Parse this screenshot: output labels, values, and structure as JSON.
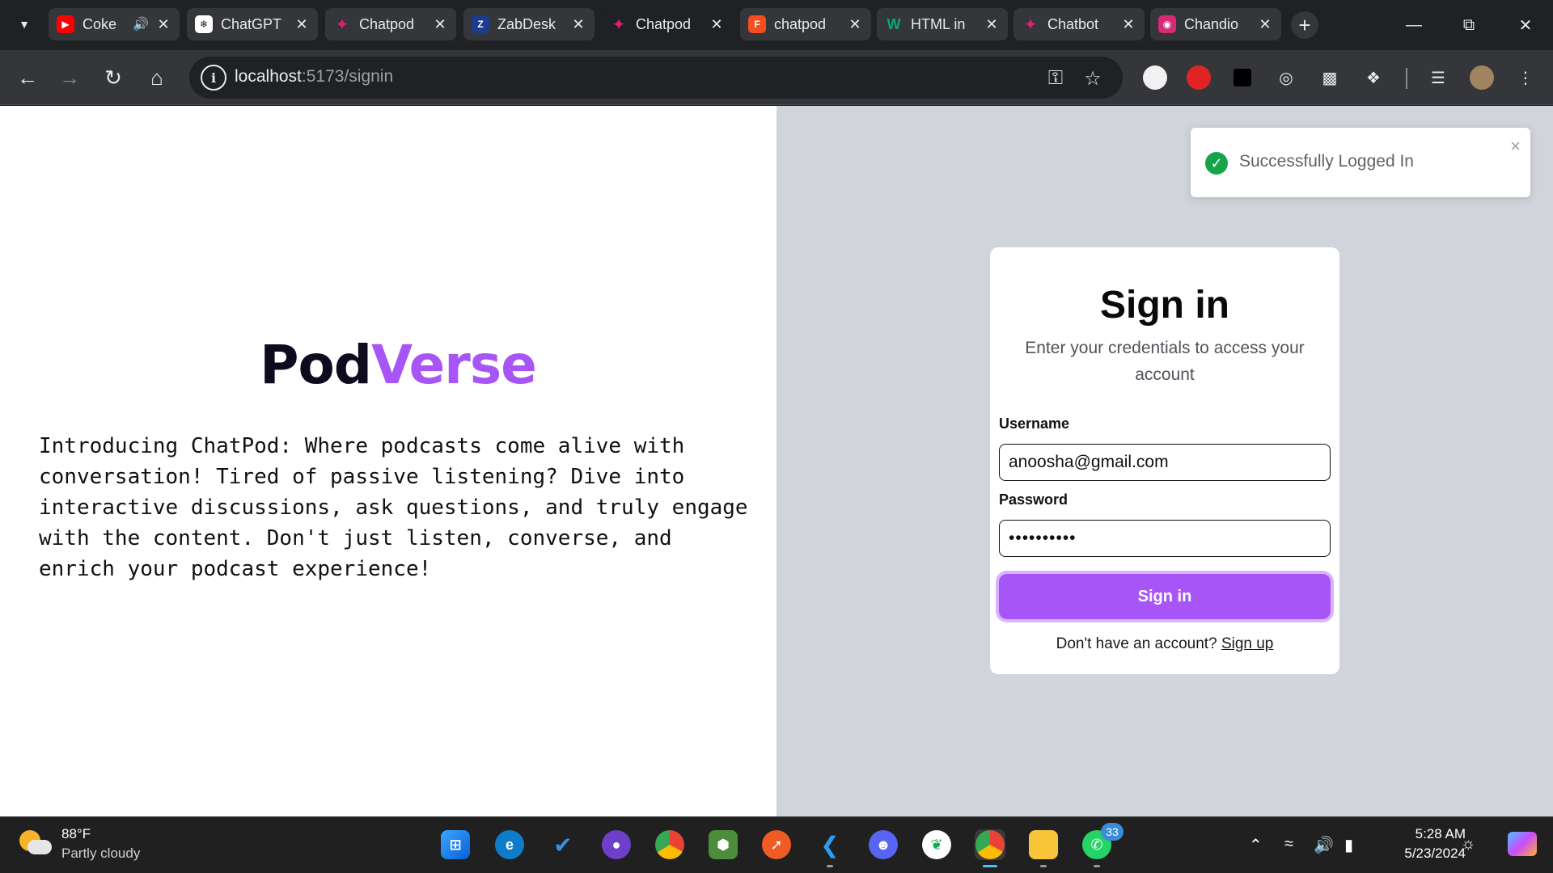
{
  "browser": {
    "tabs": [
      {
        "title": "Coke",
        "favicon": "youtube-icon",
        "color": "#ff0000"
      },
      {
        "title": "ChatGPT",
        "favicon": "chatgpt-icon",
        "color": "#ffffff"
      },
      {
        "title": "Chatpod",
        "favicon": "chatpod-icon",
        "color": "#e11d74"
      },
      {
        "title": "ZabDesk",
        "favicon": "zabdesk-icon",
        "color": "#1e3a8a"
      },
      {
        "title": "Chatpod",
        "favicon": "chatpod-icon",
        "color": "#e11d74"
      },
      {
        "title": "chatpod",
        "favicon": "figma-icon",
        "color": "#f24e1e"
      },
      {
        "title": "HTML in",
        "favicon": "w3schools-icon",
        "color": "#04aa6d"
      },
      {
        "title": "Chatbot",
        "favicon": "chatbot-icon",
        "color": "#e11d74"
      },
      {
        "title": "Chandio",
        "favicon": "instagram-icon",
        "color": "#d62976"
      }
    ],
    "new_tab_label": "+",
    "address": {
      "host": "localhost",
      "path": ":5173/signin"
    }
  },
  "page": {
    "brand": {
      "first": "Pod",
      "second": "Verse"
    },
    "intro": "Introducing ChatPod: Where podcasts come alive with conversation! Tired of passive listening? Dive into interactive discussions, ask questions, and truly engage with the content. Don't just listen, converse, and enrich your podcast experience!",
    "toast": {
      "message": "Successfully Logged In",
      "close": "×"
    },
    "signin": {
      "title": "Sign in",
      "subtitle": "Enter your credentials to access your account",
      "username_label": "Username",
      "username_value": "anoosha@gmail.com",
      "password_label": "Password",
      "password_value": "••••••••••",
      "submit_label": "Sign in",
      "signup_prompt": "Don't have an account?",
      "signup_link": "Sign up"
    },
    "colors": {
      "accent": "#a855f7",
      "right_bg": "#d1d5db",
      "success": "#16a34a"
    }
  },
  "taskbar": {
    "weather": {
      "temp": "88°F",
      "desc": "Partly cloudy"
    },
    "apps": [
      "windows-start-icon",
      "edge-icon",
      "todo-icon",
      "github-desktop-icon",
      "chrome-icon",
      "node-icon",
      "postman-icon",
      "vscode-icon",
      "discord-icon",
      "mongodb-icon",
      "chrome-active-icon",
      "file-explorer-icon",
      "whatsapp-icon"
    ],
    "whatsapp_badge": "33",
    "clock": {
      "time": "5:28 AM",
      "date": "5/23/2024"
    }
  }
}
